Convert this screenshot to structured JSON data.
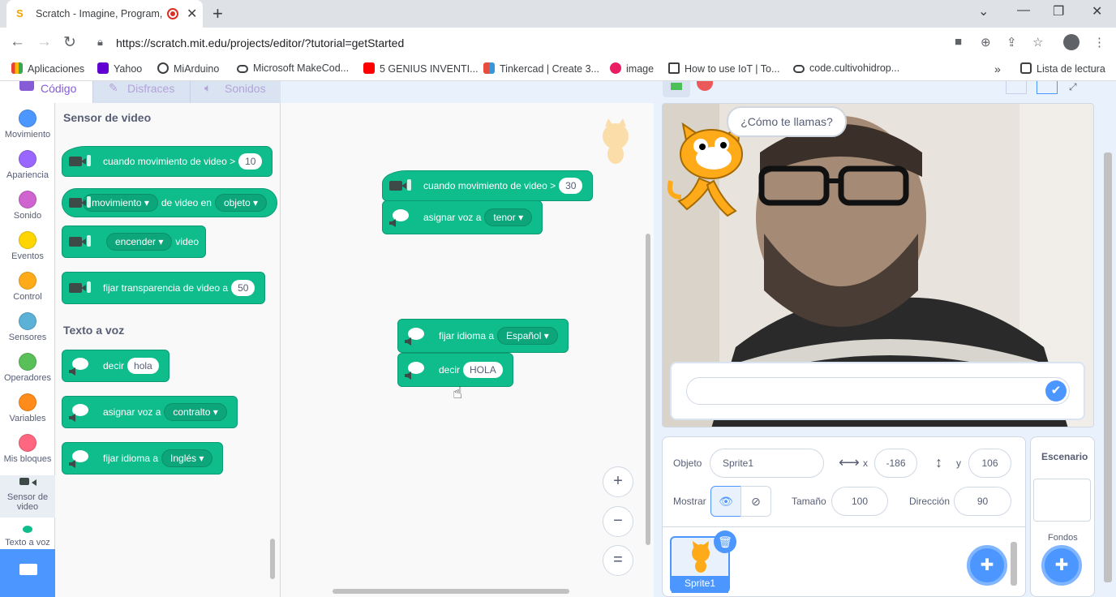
{
  "browser": {
    "tab_title": "Scratch - Imagine, Program,",
    "favicon": "S",
    "new_tab": "+",
    "close": "✕",
    "url": "https://scratch.mit.edu/projects/editor/?tutorial=getStarted",
    "bookmarks": [
      "Aplicaciones",
      "Yahoo",
      "MiArduino",
      "Microsoft MakeCod...",
      "5 GENIUS INVENTI...",
      "Tinkercad | Create 3...",
      "image",
      "How to use IoT | To...",
      "code.cultivohidrop..."
    ],
    "more": "»",
    "reading_list": "Lista de lectura"
  },
  "scratch": {
    "tabs": {
      "code": "Código",
      "costumes": "Disfraces",
      "sounds": "Sonidos"
    },
    "categories": [
      {
        "label": "Movimiento",
        "color": "#4c97ff"
      },
      {
        "label": "Apariencia",
        "color": "#9966ff"
      },
      {
        "label": "Sonido",
        "color": "#cf63cf"
      },
      {
        "label": "Eventos",
        "color": "#ffd500"
      },
      {
        "label": "Control",
        "color": "#ffab19"
      },
      {
        "label": "Sensores",
        "color": "#5cb1d6"
      },
      {
        "label": "Operadores",
        "color": "#59c059"
      },
      {
        "label": "Variables",
        "color": "#ff8c1a"
      },
      {
        "label": "Mis bloques",
        "color": "#ff6680"
      }
    ],
    "cat_video": "Sensor de video",
    "cat_tts": "Texto a voz",
    "palette": {
      "video_heading": "Sensor de video",
      "b1_text": "cuando movimiento de video >",
      "b1_val": "10",
      "b2_dd": "movimiento",
      "b2_text": "de video en",
      "b2_dd2": "objeto",
      "b3_dd": "encender",
      "b3_text": "video",
      "b4_text": "fijar transparencia de video a",
      "b4_val": "50",
      "tts_heading": "Texto a voz",
      "b5_text": "decir",
      "b5_val": "hola",
      "b6_text": "asignar voz a",
      "b6_dd": "contralto",
      "b7_text": "fijar idioma a",
      "b7_dd": "Inglés"
    },
    "workspace": {
      "w1_text": "cuando movimiento de video >",
      "w1_val": "30",
      "w2_text": "asignar voz a",
      "w2_dd": "tenor",
      "w3_text": "fijar idioma a",
      "w3_dd": "Español",
      "w4_text": "decir",
      "w4_val": "HOLA"
    },
    "zoom": {
      "in": "+",
      "out": "−",
      "reset": "="
    },
    "stage": {
      "say": "¿Cómo te llamas?"
    },
    "sprite": {
      "label_object": "Objeto",
      "name": "Sprite1",
      "label_x": "x",
      "x": "-186",
      "label_y": "y",
      "y": "106",
      "label_show": "Mostrar",
      "label_size": "Tamaño",
      "size": "100",
      "label_direction": "Dirección",
      "direction": "90",
      "thumb_name": "Sprite1"
    },
    "stage_panel": {
      "title": "Escenario",
      "backdrops": "Fondos"
    }
  }
}
